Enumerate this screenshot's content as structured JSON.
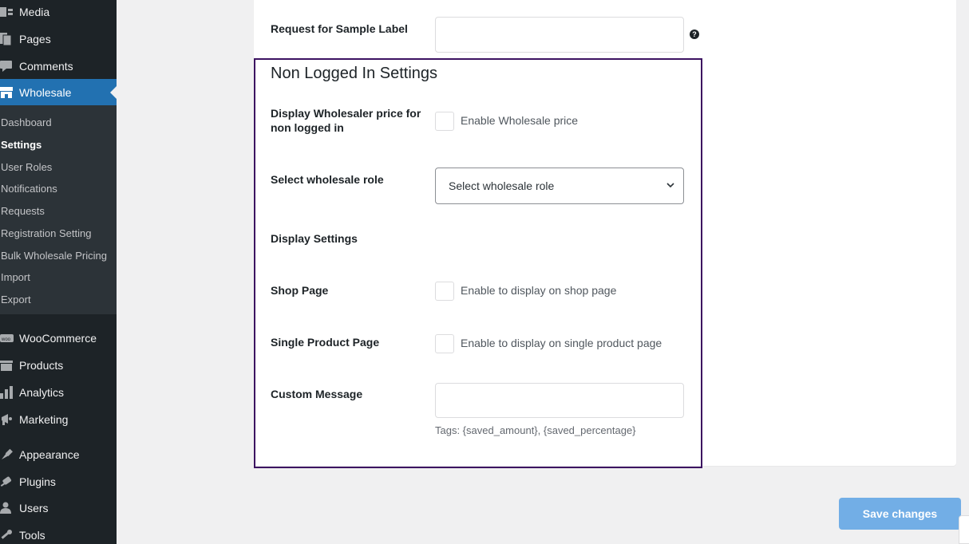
{
  "sidebar": {
    "top_items": [
      {
        "label": "Media",
        "icon": "media-icon"
      },
      {
        "label": "Pages",
        "icon": "pages-icon"
      },
      {
        "label": "Comments",
        "icon": "comments-icon"
      },
      {
        "label": "Wholesale",
        "icon": "store-icon"
      }
    ],
    "submenu": [
      "Dashboard",
      "Settings",
      "User Roles",
      "Notifications",
      "Requests",
      "Registration Setting",
      "Bulk Wholesale Pricing",
      "Import",
      "Export"
    ],
    "bottom_items": [
      {
        "label": "WooCommerce",
        "icon": "woocommerce-icon"
      },
      {
        "label": "Products",
        "icon": "products-icon"
      },
      {
        "label": "Analytics",
        "icon": "analytics-icon"
      },
      {
        "label": "Marketing",
        "icon": "marketing-icon"
      },
      {
        "label": "Appearance",
        "icon": "appearance-icon"
      },
      {
        "label": "Plugins",
        "icon": "plugins-icon"
      },
      {
        "label": "Users",
        "icon": "users-icon"
      },
      {
        "label": "Tools",
        "icon": "tools-icon"
      }
    ],
    "active_item": "Wholesale",
    "current_submenu": "Settings"
  },
  "form": {
    "sample_label": "Request for Sample Label",
    "sample_value": "",
    "help_glyph": "?",
    "section_title": "Non Logged In Settings",
    "display_price_label": "Display Wholesaler price for non logged in",
    "enable_price_text": "Enable Wholesale price",
    "select_role_label": "Select wholesale role",
    "select_role_value": "Select wholesale role",
    "display_settings_label": "Display Settings",
    "shop_page_label": "Shop Page",
    "shop_page_text": "Enable to display on shop page",
    "single_page_label": "Single Product Page",
    "single_page_text": "Enable to display on single product page",
    "custom_message_label": "Custom Message",
    "custom_message_value": "",
    "tags_text": "Tags: {saved_amount}, {saved_percentage}"
  },
  "actions": {
    "save_label": "Save changes"
  },
  "colors": {
    "sidebar_bg": "#1d2327",
    "active_bg": "#2271b1",
    "highlight_border": "#3c1361",
    "save_button": "#72aee6"
  }
}
